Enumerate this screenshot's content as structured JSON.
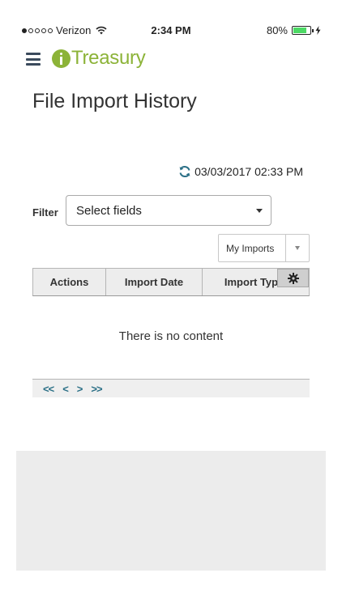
{
  "status_bar": {
    "carrier": "Verizon",
    "time": "2:34 PM",
    "battery_percent": "80%",
    "battery_level": 0.8,
    "signal_bars_filled": 1,
    "signal_bars_total": 5
  },
  "header": {
    "menu_icon": "hamburger-menu-icon",
    "logo_text": "Treasury",
    "brand_color": "#8cb338"
  },
  "page": {
    "title": "File Import History",
    "last_refresh": "03/03/2017 02:33 PM"
  },
  "filter": {
    "label": "Filter",
    "placeholder": "Select fields"
  },
  "imports_dropdown": {
    "selected": "My Imports"
  },
  "grid": {
    "columns": [
      "Actions",
      "Import Date",
      "Import Typ"
    ],
    "empty_message": "There is no content"
  },
  "pager": {
    "first": "<<",
    "prev": "<",
    "next": ">",
    "last": ">>"
  },
  "colors": {
    "link_color": "#2a6f86",
    "refresh_icon_color": "#2a6f86"
  }
}
